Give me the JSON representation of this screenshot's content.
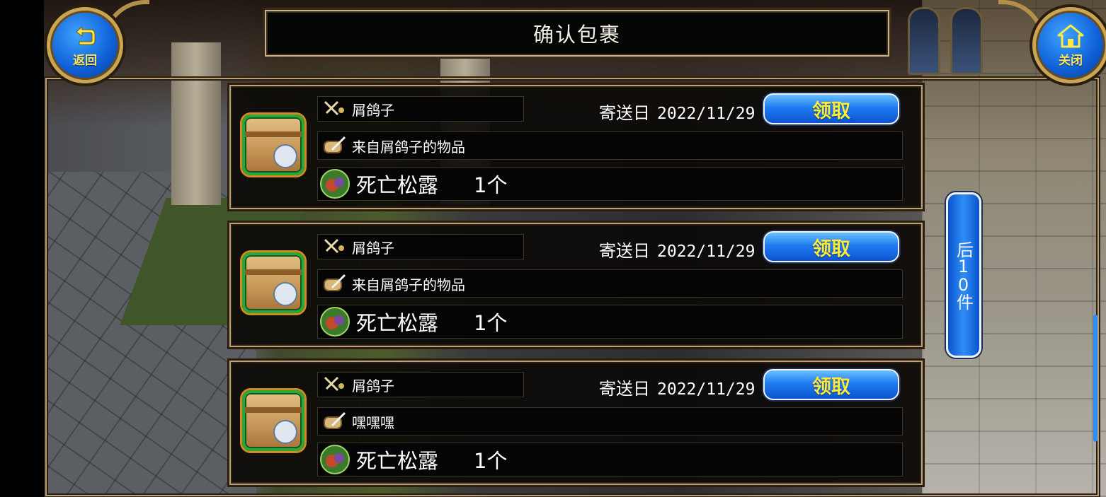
{
  "header": {
    "title": "确认包裹"
  },
  "nav": {
    "back_label": "返回",
    "close_label": "关闭"
  },
  "mails": [
    {
      "sender": "屑鸽子",
      "send_label": "寄送日",
      "date": "2022/11/29",
      "claim_label": "领取",
      "subject": "来自屑鸽子的物品",
      "item_name": "死亡松露",
      "item_qty": "1个"
    },
    {
      "sender": "屑鸽子",
      "send_label": "寄送日",
      "date": "2022/11/29",
      "claim_label": "领取",
      "subject": "来自屑鸽子的物品",
      "item_name": "死亡松露",
      "item_qty": "1个"
    },
    {
      "sender": "屑鸽子",
      "send_label": "寄送日",
      "date": "2022/11/29",
      "claim_label": "领取",
      "subject": "嘿嘿嘿",
      "item_name": "死亡松露",
      "item_qty": "1个"
    }
  ],
  "pager": {
    "next_label": "后10件"
  },
  "icons": {
    "back": "back-arrow-icon",
    "close": "home-icon",
    "sender": "crossed-swords-icon",
    "subject": "scroll-quill-icon",
    "item": "truffle-icon",
    "parcel": "parcel-box-icon"
  },
  "colors": {
    "accent_blue": "#1f7cf0",
    "claim_text": "#ffec3a",
    "frame_gold": "#b9a37b"
  }
}
